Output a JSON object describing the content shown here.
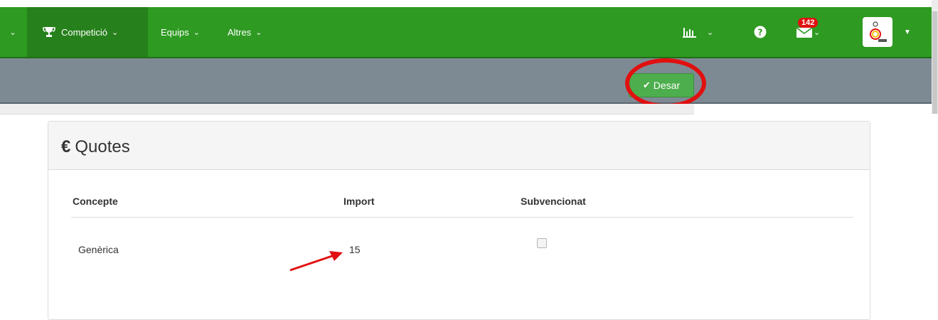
{
  "navbar": {
    "items": [
      {
        "label": "Competició",
        "icon": "trophy-icon"
      },
      {
        "label": "Equips"
      },
      {
        "label": "Altres"
      }
    ],
    "mail_count": "142",
    "colors": {
      "navbar": "#2e9a22",
      "toolbar": "#7d8a94",
      "save": "#4cae4c",
      "highlight": "#e11010"
    }
  },
  "toolbar": {
    "save_label": "Desar"
  },
  "panel": {
    "title": "Quotes",
    "currency_symbol": "€",
    "columns": [
      "Concepte",
      "Import",
      "Subvencionat"
    ],
    "rows": [
      {
        "concepte": "Genèrica",
        "import": "15",
        "subvencionat": false
      }
    ]
  }
}
